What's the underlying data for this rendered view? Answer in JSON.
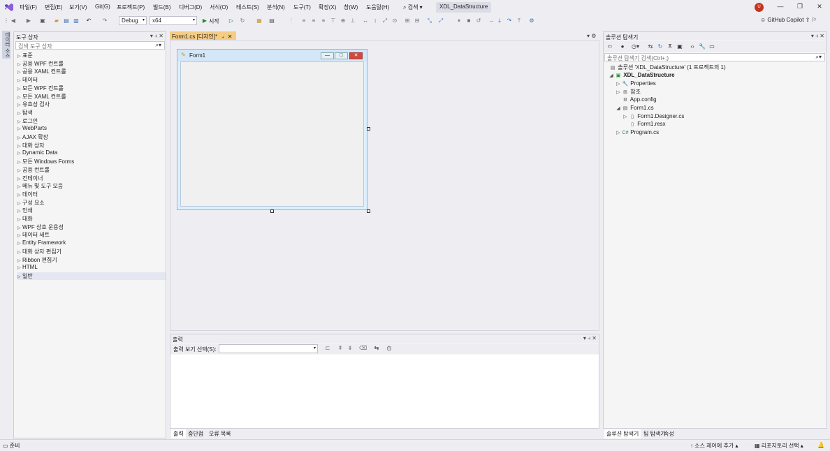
{
  "menu": {
    "items": [
      "파일(F)",
      "편집(E)",
      "보기(V)",
      "Git(G)",
      "프로젝트(P)",
      "빌드(B)",
      "디버그(D)",
      "서식(O)",
      "테스트(S)",
      "분석(N)",
      "도구(T)",
      "확장(X)",
      "창(W)",
      "도움말(H)"
    ],
    "search": "검색",
    "title": "XDL_DataStructure"
  },
  "user_avatar": "U",
  "toolbar": {
    "config": "Debug",
    "platform": "x64",
    "start": "시작",
    "copilot": "GitHub Copilot"
  },
  "toolbox": {
    "title": "도구 상자",
    "search_placeholder": "검색 도구 상자",
    "categories": [
      "표준",
      "공용 WPF 컨트롤",
      "공용 XAML 컨트롤",
      "데이터",
      "모든 WPF 컨트롤",
      "모든 XAML 컨트롤",
      "유효성 검사",
      "탐색",
      "로그인",
      "WebParts",
      "AJAX 확장",
      "대화 상자",
      "Dynamic Data",
      "모든 Windows Forms",
      "공용 컨트롤",
      "컨테이너",
      "메뉴 및 도구 모음",
      "데이터",
      "구성 요소",
      "인쇄",
      "대화",
      "WPF 상호 운용성",
      "데이터 세트",
      "Entity Framework",
      "대화 상자 편집기",
      "Ribbon 편집기",
      "HTML",
      "일반"
    ]
  },
  "left_strip_tab": "데이터 소스",
  "editor": {
    "tab_label": "Form1.cs [디자인]*",
    "form_title": "Form1"
  },
  "output": {
    "title": "출력",
    "show_label": "출력 보기 선택(S):",
    "tabs": [
      "출력",
      "중단점",
      "오류 목록"
    ]
  },
  "solution_explorer": {
    "title": "솔루션 탐색기",
    "search_placeholder": "솔루션 탐색기 검색(Ctrl+;)",
    "solution_label": "솔루션 'XDL_DataStructure' (1 프로젝트의 1)",
    "project": "XDL_DataStructure",
    "items": [
      "Properties",
      "참조",
      "App.config",
      "Form1.cs",
      "Form1.Designer.cs",
      "Form1.resx",
      "Program.cs"
    ],
    "tabs": [
      "솔루션 탐색기",
      "팀 탐색기",
      "속성"
    ]
  },
  "status": {
    "ready": "준비",
    "source_control": "소스 제어에 추가",
    "repo": "리포지토리 선택"
  }
}
